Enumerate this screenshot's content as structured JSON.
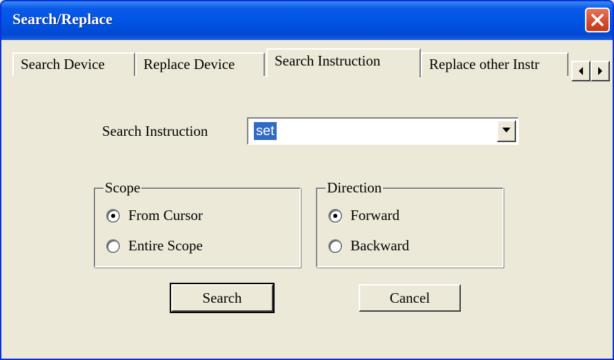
{
  "window": {
    "title": "Search/Replace",
    "close_icon": "close-icon"
  },
  "tabs": [
    {
      "label": "Search Device",
      "active": false
    },
    {
      "label": "Replace Device",
      "active": false
    },
    {
      "label": "Search Instruction",
      "active": true
    },
    {
      "label": "Replace other Instr",
      "active": false
    }
  ],
  "tab_scroll": {
    "left_icon": "arrow-left-icon",
    "right_icon": "arrow-right-icon"
  },
  "search": {
    "label": "Search Instruction",
    "value": "set",
    "dropdown_icon": "chevron-down-icon"
  },
  "scope": {
    "caption": "Scope",
    "options": [
      {
        "label": "From Cursor",
        "selected": true
      },
      {
        "label": "Entire Scope",
        "selected": false
      }
    ]
  },
  "direction": {
    "caption": "Direction",
    "options": [
      {
        "label": "Forward",
        "selected": true
      },
      {
        "label": "Backward",
        "selected": false
      }
    ]
  },
  "buttons": {
    "search_label": "Search",
    "cancel_label": "Cancel"
  },
  "colors": {
    "title_bar": "#0055e5",
    "dialog_bg": "#ece9d8",
    "selection": "#316ac5",
    "close_button": "#d34b2c"
  }
}
